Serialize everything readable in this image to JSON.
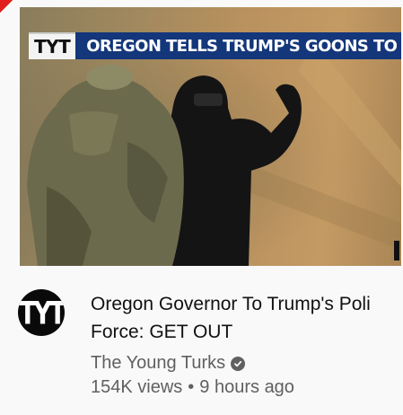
{
  "thumbnail": {
    "logo_text": "TYT",
    "headline": "OREGON TELLS TRUMP'S GOONS TO LEAV"
  },
  "channel": {
    "avatar_text": "TYT",
    "name": "The Young Turks",
    "verified_icon": "check-circle-icon"
  },
  "video": {
    "title_line1": "Oregon Governor To Trump's Poli",
    "title_line2": "Force: GET OUT",
    "views": "154K views",
    "separator": "•",
    "age": "9 hours ago"
  },
  "colors": {
    "banner_blue": "#14367a",
    "text_primary": "#111111",
    "text_secondary": "#606060",
    "background": "#f9f9f9"
  }
}
